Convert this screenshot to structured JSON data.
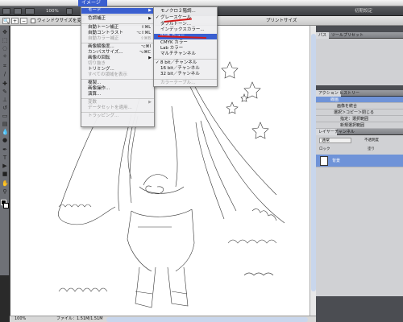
{
  "menubar": {
    "apple": "",
    "active_menu": "イメージ"
  },
  "toolbar": {
    "zoom": "100%",
    "workspace": "初期設定"
  },
  "options": {
    "fit_window": "ウィンドウサイズを変更",
    "print_size": "プリントサイズ"
  },
  "image_menu": {
    "items": [
      {
        "label": "モード",
        "arrow": "▶",
        "highlight": true
      },
      {
        "label": "色調補正",
        "arrow": "▶"
      },
      {
        "label": "自動トーン補正",
        "sc": "⇧⌘L"
      },
      {
        "label": "自動コントラスト",
        "sc": "⌥⇧⌘L"
      },
      {
        "label": "自動カラー補正",
        "sc": "⇧⌘B",
        "dis": true
      },
      {
        "label": "画像解像度...",
        "sc": "⌥⌘I"
      },
      {
        "label": "カンバスサイズ...",
        "sc": "⌥⌘C"
      },
      {
        "label": "画像の回転",
        "arrow": "▶"
      },
      {
        "label": "切り抜き",
        "dis": true
      },
      {
        "label": "トリミング..."
      },
      {
        "label": "すべての領域を表示",
        "dis": true
      },
      {
        "label": "複製..."
      },
      {
        "label": "画像操作..."
      },
      {
        "label": "演算..."
      },
      {
        "label": "変数",
        "arrow": "▶",
        "dis": true
      },
      {
        "label": "データセットを適用...",
        "dis": true
      },
      {
        "label": "トラッピング...",
        "dis": true
      }
    ]
  },
  "mode_menu": {
    "items": [
      {
        "label": "モノクロ２階調..."
      },
      {
        "label": "グレースケール",
        "check": "✓"
      },
      {
        "label": "ダブルトーン..."
      },
      {
        "label": "インデックスカラー..."
      },
      {
        "label": "RGB カラー",
        "highlight": true
      },
      {
        "label": "CMYK カラー"
      },
      {
        "label": "Lab カラー"
      },
      {
        "label": "マルチチャンネル"
      },
      {
        "label": "8 bit／チャンネル",
        "check": "✓"
      },
      {
        "label": "16 bit／チャンネル"
      },
      {
        "label": "32 bit／チャンネル"
      },
      {
        "label": "カラーテーブル...",
        "dis": true
      }
    ]
  },
  "panels": {
    "top_tabs": [
      "パス",
      "ツールプリセット"
    ],
    "actions_tabs": [
      "アクション",
      "ヒストリー"
    ],
    "action_rows": [
      "線画",
      "画像を統合",
      "選択＞コピー＞閉じる",
      "指定：選択範囲",
      "新規選択範囲"
    ],
    "layers_tabs": [
      "レイヤー",
      "チャンネル"
    ],
    "blend_mode": "通常",
    "opacity_label": "不透明度",
    "lock_label": "ロック",
    "fill_label": "塗り",
    "layer_name": "背景"
  },
  "status": {
    "zoom": "100%",
    "file": "ファイル：1.51M/1.51M"
  }
}
